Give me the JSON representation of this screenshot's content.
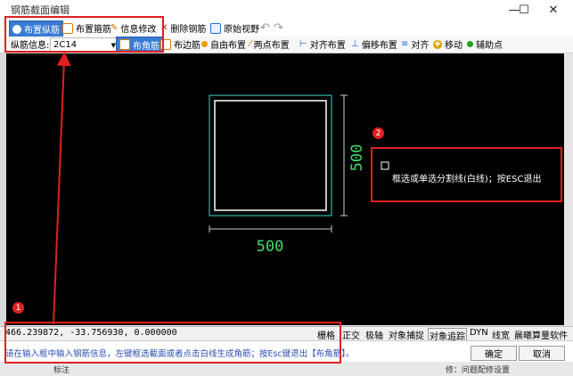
{
  "window": {
    "title": "钢筋截面编辑",
    "controls": {
      "minimize": "—",
      "maximize": "☐",
      "close": "✕"
    }
  },
  "toolbar1": {
    "items": [
      {
        "label": "布置纵筋",
        "icon": "circle-icon",
        "active": true
      },
      {
        "label": "布置箍筋",
        "icon": "stirrup-icon"
      },
      {
        "label": "信息修改",
        "icon": "edit-icon"
      },
      {
        "label": "删除钢筋",
        "icon": "delete-icon"
      },
      {
        "label": "原始视野",
        "icon": "view-icon"
      }
    ],
    "undo_icon": "undo-icon",
    "redo_icon": "redo-icon"
  },
  "toolbar2": {
    "rebar_label": "纵筋信息:",
    "rebar_value": "2C14",
    "items": [
      {
        "label": "布角筋",
        "active": true
      },
      {
        "label": "布边筋"
      },
      {
        "label": "自由布置"
      },
      {
        "label": "两点布置"
      },
      {
        "label": "对齐布置"
      },
      {
        "label": "偏移布置"
      },
      {
        "label": "对齐"
      },
      {
        "label": "移动"
      },
      {
        "label": "辅助点"
      }
    ]
  },
  "canvas": {
    "dim_horizontal": "500",
    "dim_vertical": "500",
    "cursor_prompt": "框选或单选分割线(白线)；按ESC退出"
  },
  "statusbar": {
    "coords": "466.239872, -33.756930, 0.000000",
    "toggles": [
      "栅格",
      "正交",
      "极轴",
      "对象捕捉",
      "对象追踪",
      "DYN",
      "线宽",
      "晨曦算量软件"
    ]
  },
  "cmdbar": {
    "prompt": "请在输入框中输入钢筋信息，左键框选截面或者点击白线生成角筋；按Esc键退出【布角筋】。",
    "ok_label": "确定",
    "cancel_label": "取消"
  },
  "bottomstrip": {
    "left_text": "标注",
    "right_text": "修：问题配修设置"
  },
  "annotations": {
    "badge1": "1",
    "badge2": "2"
  },
  "colors": {
    "highlight": "#e02020",
    "active": "#3a7bd5",
    "section_outer": "#3fd6c8",
    "section_inner": "#ffffff",
    "dimension": "#3fdc6a"
  }
}
